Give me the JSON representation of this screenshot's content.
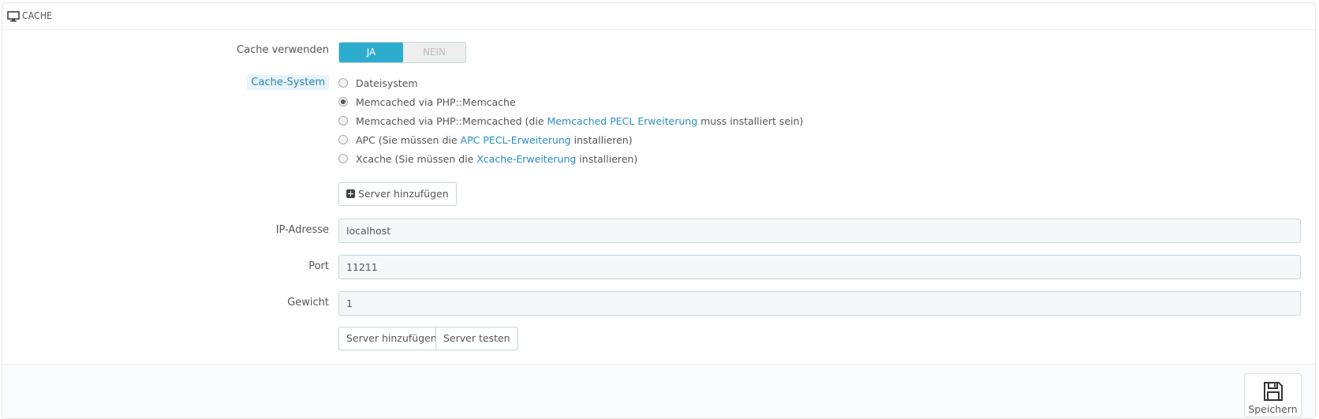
{
  "panel": {
    "title": "CACHE",
    "icon": "desktop-icon"
  },
  "form": {
    "use_cache": {
      "label": "Cache verwenden",
      "on_label": "JA",
      "off_label": "NEIN",
      "value": "JA"
    },
    "cache_system": {
      "label": "Cache-System",
      "options": [
        {
          "text": "Dateisystem",
          "checked": false
        },
        {
          "text": "Memcached via PHP::Memcache",
          "checked": true
        },
        {
          "pre": "Memcached via PHP::Memcached (die ",
          "link": "Memcached PECL Erweiterung",
          "post": " muss installiert sein)",
          "checked": false
        },
        {
          "pre": "APC (Sie müssen die ",
          "link": "APC PECL-Erweiterung",
          "post": " installieren)",
          "checked": false
        },
        {
          "pre": "Xcache (Sie müssen die ",
          "link": "Xcache-Erweiterung",
          "post": " installieren)",
          "checked": false
        }
      ]
    },
    "add_server_top_label": "Server hinzufügen",
    "ip": {
      "label": "IP-Adresse",
      "value": "localhost"
    },
    "port": {
      "label": "Port",
      "value": "11211"
    },
    "weight": {
      "label": "Gewicht",
      "value": "1"
    },
    "add_server_label": "Server hinzufügen",
    "test_server_label": "Server testen"
  },
  "footer": {
    "save_label": "Speichern",
    "save_icon": "save-icon"
  },
  "colors": {
    "accent": "#2eacce",
    "link": "#2a8ec2",
    "highlight_bg": "#e8f3fa"
  }
}
